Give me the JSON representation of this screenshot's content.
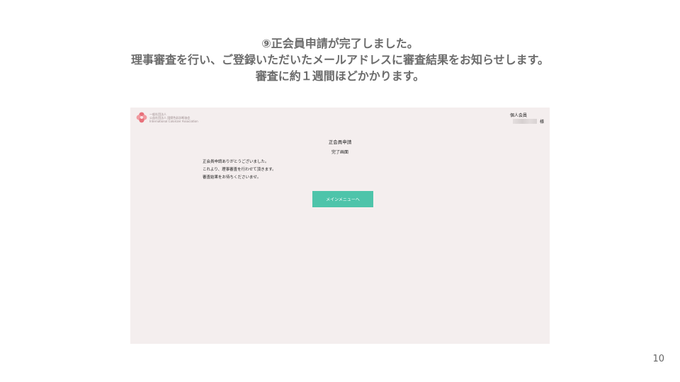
{
  "slide": {
    "heading_line1": "⑨正会員申請が完了しました。",
    "heading_line2": "理事審査を行い、ご登録いただいたメールアドレスに審査結果をお知らせします。",
    "heading_line3": "審査に約１週間ほどかかります。",
    "page_number": "10"
  },
  "screen": {
    "logo": {
      "icon": "flower-logo-icon",
      "line1": "一般社団法人",
      "line2": "公益社団法人 国際色彩診断協会",
      "line3": "International Colorizer Association"
    },
    "header": {
      "member_type": "個人会員",
      "name_suffix": "様"
    },
    "form_title": "正会員申請",
    "form_subtitle": "完了画面",
    "message": {
      "line1": "正会員申請ありがとうございました。",
      "line2": "これより、理事審査を行わせて頂きます。",
      "line3": "審査結果をお待ちくださいませ。"
    },
    "main_menu_button": "メインメニューへ",
    "colors": {
      "background": "#f4eeee",
      "button": "#4ec4aa",
      "logo": "#e8707a"
    }
  }
}
